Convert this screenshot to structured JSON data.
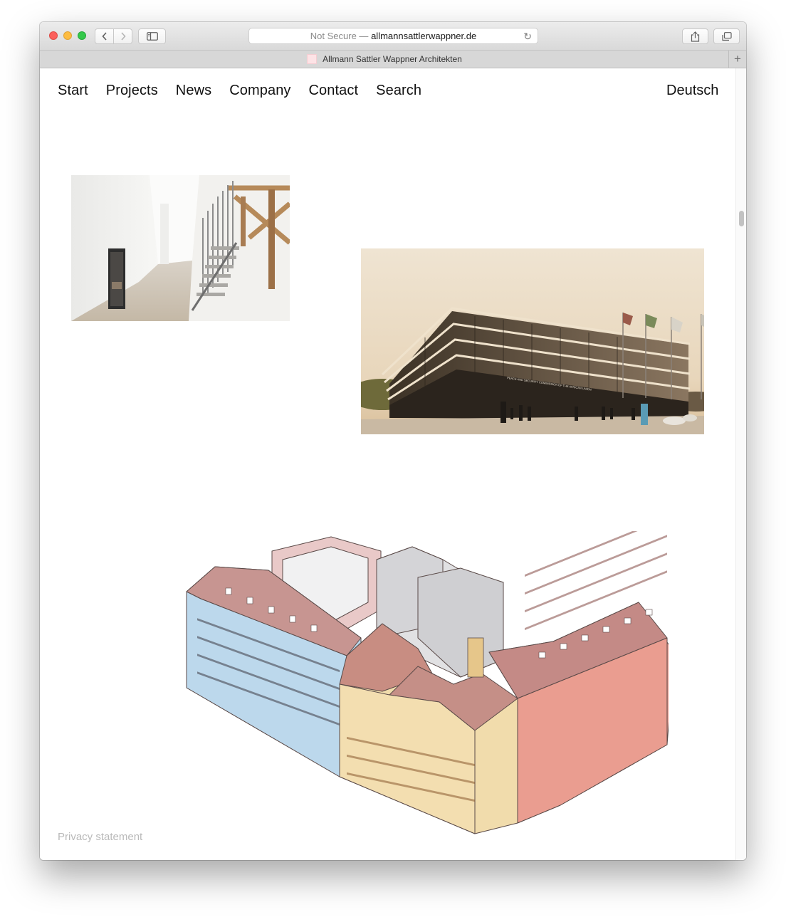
{
  "browser": {
    "address": {
      "secure_label": "Not Secure —",
      "domain": "allmannsattlerwappner.de"
    },
    "tab_title": "Allmann Sattler Wappner Architekten",
    "new_tab_glyph": "+",
    "reload_glyph": "↻",
    "icons": [
      "back-icon",
      "forward-icon",
      "sidebar-icon",
      "share-icon",
      "tabs-icon",
      "reload-icon"
    ]
  },
  "nav": {
    "items": [
      "Start",
      "Projects",
      "News",
      "Company",
      "Contact",
      "Search"
    ],
    "language": "Deutsch"
  },
  "images": [
    {
      "subject": "interior hallway with staircase and timber roof beams"
    },
    {
      "subject": "rendering of glass office building with flags",
      "sign": "PEACE AND SECURITY COMMISSION OF THE AFRICAN UNION"
    },
    {
      "subject": "axonometric drawing of an urban block"
    }
  ],
  "footer": {
    "privacy_label": "Privacy statement"
  },
  "colors": {
    "text": "#111111",
    "muted": "#b9b9b9",
    "background": "#ffffff"
  }
}
